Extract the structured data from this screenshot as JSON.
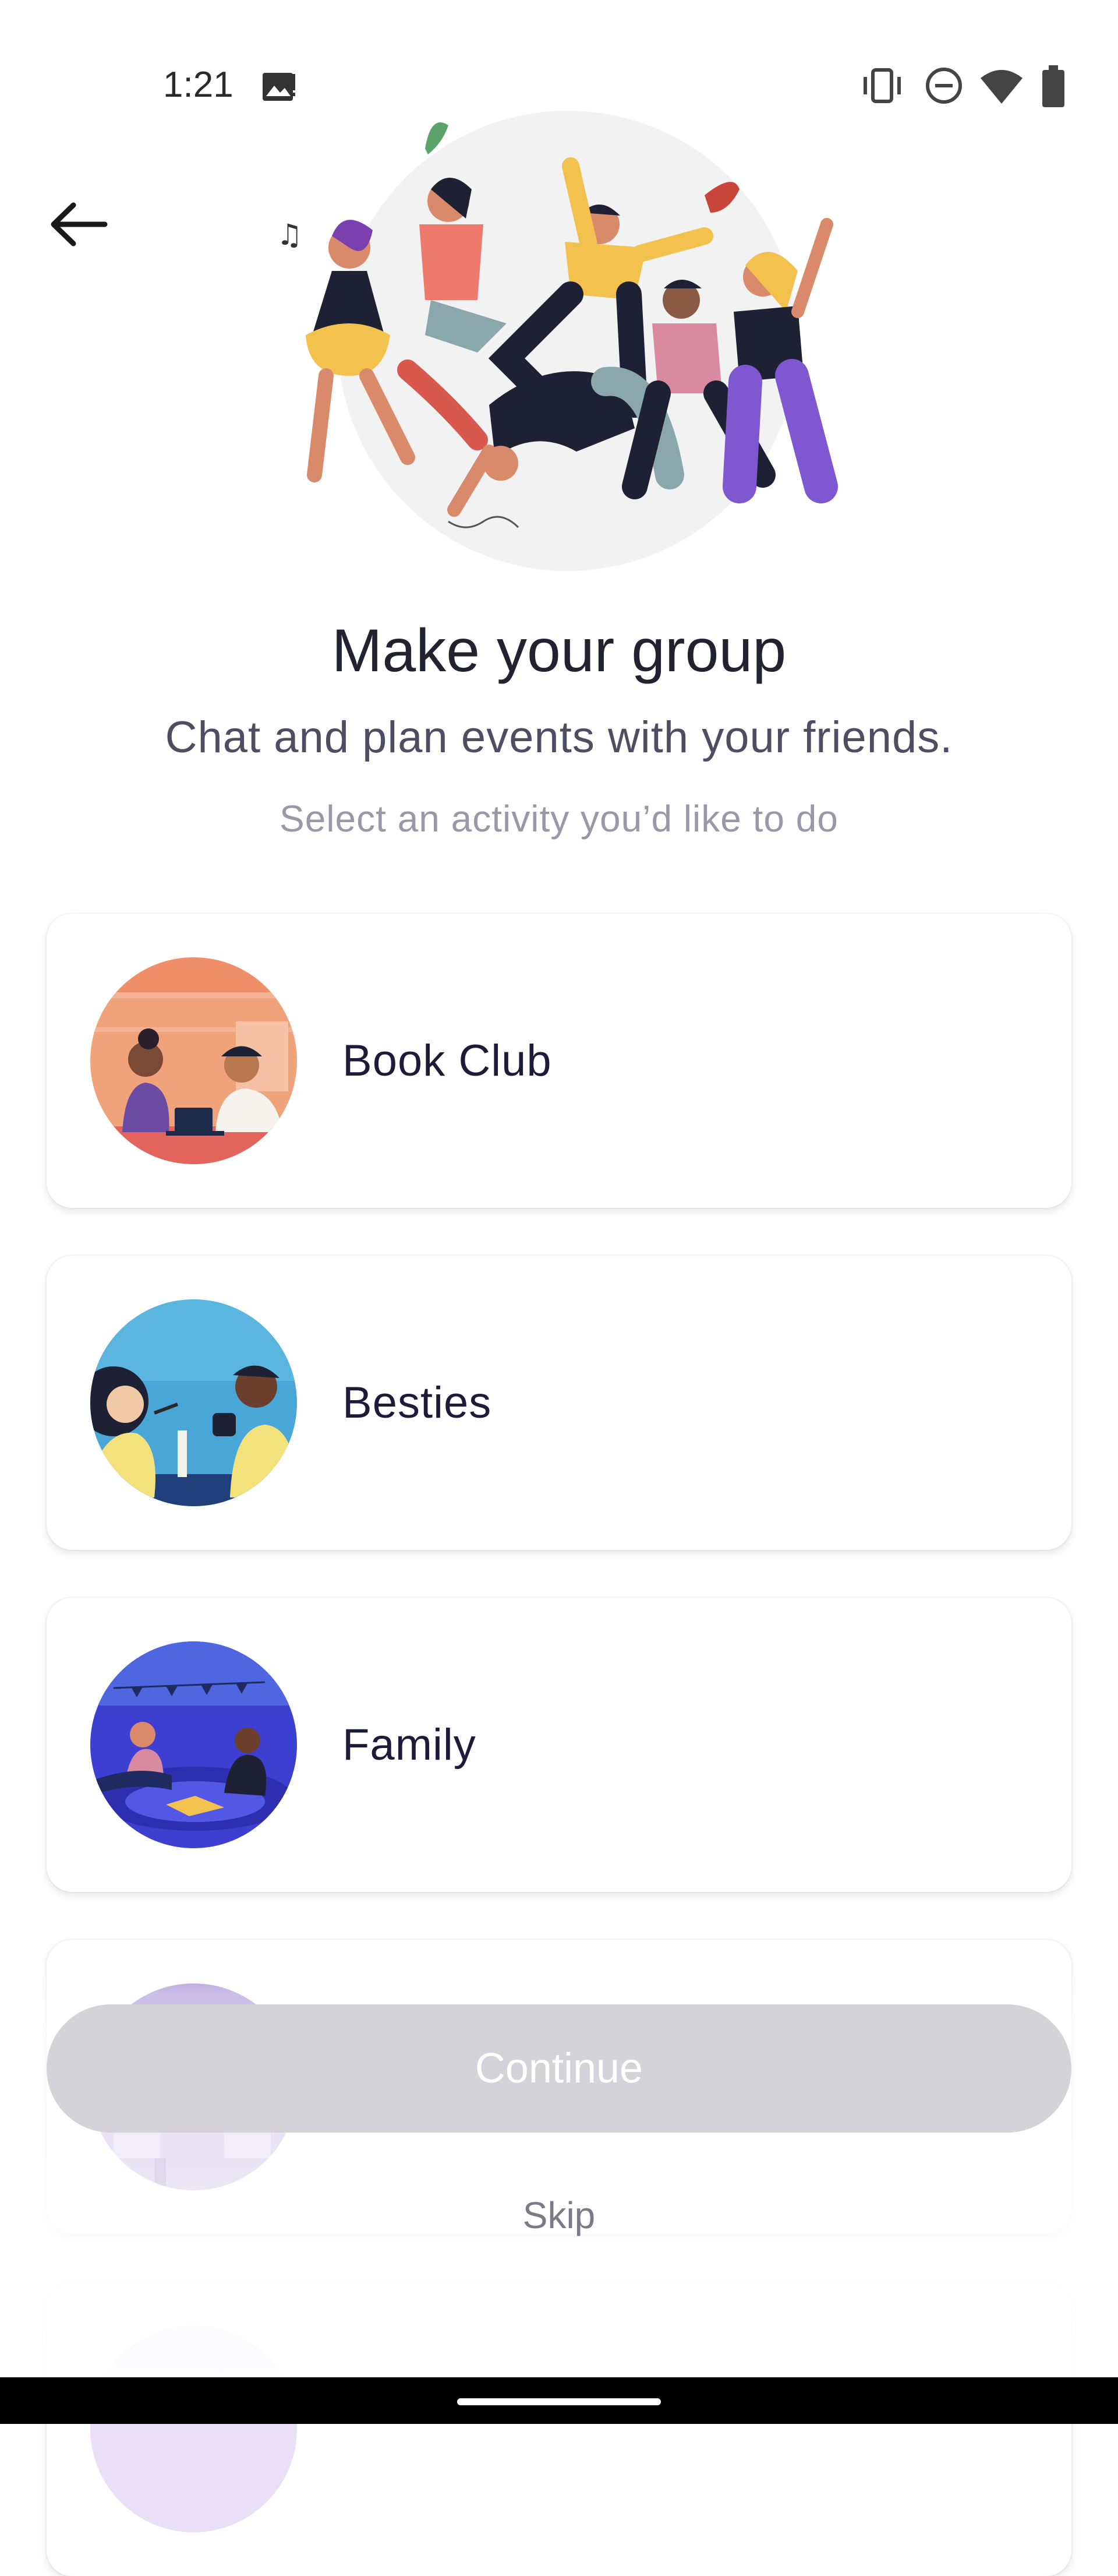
{
  "status_bar": {
    "time": "1:21",
    "icons": [
      "image-notification-icon",
      "vibrate-icon",
      "do-not-disturb-icon",
      "wifi-icon",
      "battery-icon"
    ]
  },
  "header": {
    "back_icon": "arrow-left-icon"
  },
  "intro": {
    "title": "Make your group",
    "subtitle": "Chat and plan events with your friends.",
    "hint": "Select an activity you’d like to do"
  },
  "activities": [
    {
      "label": "Book Club",
      "image": "book-club-illustration"
    },
    {
      "label": "Besties",
      "image": "besties-illustration"
    },
    {
      "label": "Family",
      "image": "family-illustration"
    },
    {
      "label": "",
      "image": "purple-activity-illustration"
    },
    {
      "label": "",
      "image": "partially-visible-activity-illustration"
    }
  ],
  "footer": {
    "continue_label": "Continue",
    "skip_label": "Skip"
  },
  "colors": {
    "continue_disabled": "#d3d3d8",
    "title": "#222230",
    "card_label": "#1d1b3a"
  }
}
